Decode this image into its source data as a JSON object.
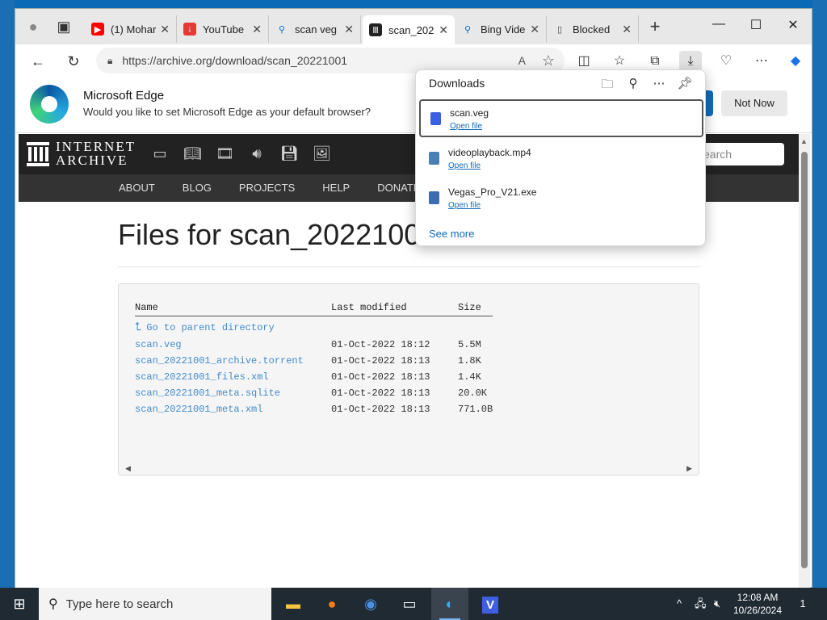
{
  "browser": {
    "tabs": [
      {
        "label": "(1) Mohar",
        "favicon": "youtube-icon",
        "color": "#ff0000"
      },
      {
        "label": "YouTube",
        "favicon": "download-icon",
        "color": "#e53935"
      },
      {
        "label": "scan veg",
        "favicon": "search-icon",
        "color": "#0f6cbd"
      },
      {
        "label": "scan_202",
        "favicon": "archive-icon",
        "color": "#222222"
      },
      {
        "label": "Bing Vide",
        "favicon": "search-icon",
        "color": "#0f6cbd"
      },
      {
        "label": "Blocked",
        "favicon": "page-icon",
        "color": "#444444"
      }
    ],
    "url": "https://archive.org/download/scan_20221001",
    "new_tab_symbol": "+"
  },
  "banner": {
    "title": "Microsoft Edge",
    "subtitle": "Would you like to set Microsoft Edge as your default browser?",
    "not_now": "Not Now"
  },
  "ia": {
    "logo_line1": "INTERNET",
    "logo_line2": "ARCHIVE",
    "search_placeholder": "earch",
    "menu": [
      "ABOUT",
      "BLOG",
      "PROJECTS",
      "HELP",
      "DONATE"
    ]
  },
  "listing": {
    "title": "Files for scan_2022100",
    "headers": {
      "name": "Name",
      "modified": "Last modified",
      "size": "Size"
    },
    "parent": "Go to parent directory",
    "rows": [
      {
        "name": "scan.veg",
        "modified": "01-Oct-2022 18:12",
        "size": "5.5M"
      },
      {
        "name": "scan_20221001_archive.torrent",
        "modified": "01-Oct-2022 18:13",
        "size": "1.8K"
      },
      {
        "name": "scan_20221001_files.xml",
        "modified": "01-Oct-2022 18:13",
        "size": "1.4K"
      },
      {
        "name": "scan_20221001_meta.sqlite",
        "modified": "01-Oct-2022 18:13",
        "size": "20.0K"
      },
      {
        "name": "scan_20221001_meta.xml",
        "modified": "01-Oct-2022 18:13",
        "size": "771.0B"
      }
    ]
  },
  "downloads": {
    "title": "Downloads",
    "items": [
      {
        "name": "scan.veg",
        "action": "Open file",
        "icon_color": "#3a5fe0"
      },
      {
        "name": "videoplayback.mp4",
        "action": "Open file",
        "icon_color": "#4a7fb5"
      },
      {
        "name": "Vegas_Pro_V21.exe",
        "action": "Open file",
        "icon_color": "#3b6db0"
      }
    ],
    "see_more": "See more"
  },
  "taskbar": {
    "search_placeholder": "Type here to search",
    "time": "12:08 AM",
    "date": "10/26/2024",
    "notification_count": "1"
  }
}
